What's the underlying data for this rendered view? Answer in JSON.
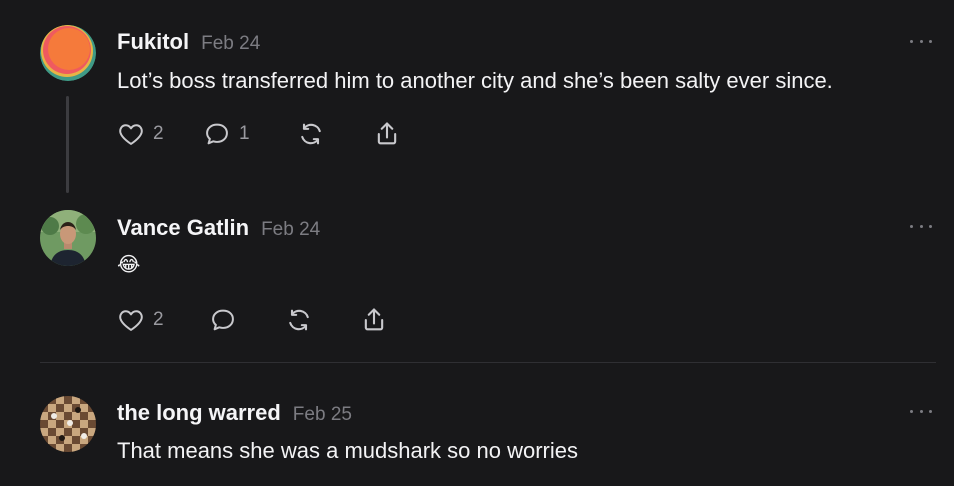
{
  "posts": [
    {
      "author": "Fukitol",
      "date": "Feb 24",
      "text": "Lot’s boss transferred him to another city and she’s been salty ever since.",
      "likes": "2",
      "replies": "1"
    },
    {
      "author": "Vance Gatlin",
      "date": "Feb 24",
      "text": "😂",
      "likes": "2",
      "replies": ""
    },
    {
      "author": "the long warred",
      "date": "Feb 25",
      "text": "That means she was a mudshark so no worries"
    }
  ],
  "colors": {
    "background": "#18181a",
    "text": "#f3f3f5",
    "muted": "#7c7c82",
    "thread_line": "#3c3c40"
  },
  "icons": [
    "heart-icon",
    "comment-icon",
    "repost-icon",
    "share-icon",
    "more-icon"
  ]
}
